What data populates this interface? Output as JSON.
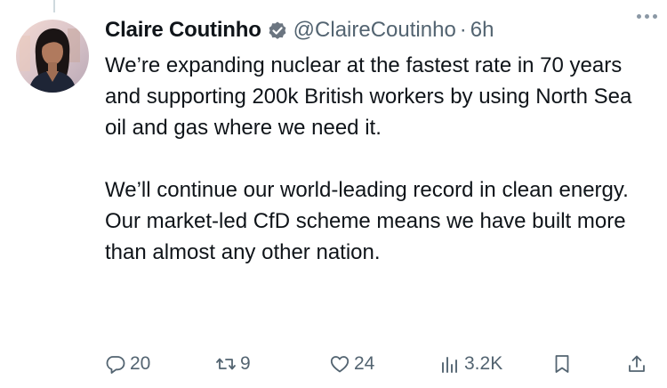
{
  "tweet": {
    "author_name": "Claire Coutinho",
    "handle": "@ClaireCoutinho",
    "separator": "·",
    "time": "6h",
    "paragraphs": [
      "We’re expanding nuclear at the fastest rate in 70 years and supporting 200k British workers by using North Sea oil and gas where we need it.",
      "We’ll continue our world-leading record in clean energy. Our market-led CfD scheme means we have built more than almost any other nation."
    ]
  },
  "actions": {
    "reply_count": "20",
    "repost_count": "9",
    "like_count": "24",
    "view_count": "3.2K"
  },
  "icons": {
    "verified": "verified-badge-icon",
    "more": "more-horizontal-icon",
    "reply": "reply-icon",
    "repost": "repost-icon",
    "like": "heart-icon",
    "views": "views-bar-icon",
    "bookmark": "bookmark-icon",
    "share": "share-icon"
  },
  "colors": {
    "text_primary": "#0f1419",
    "text_secondary": "#536471",
    "verified_badge": "#6b7580",
    "thread_line": "#cfd9de"
  }
}
